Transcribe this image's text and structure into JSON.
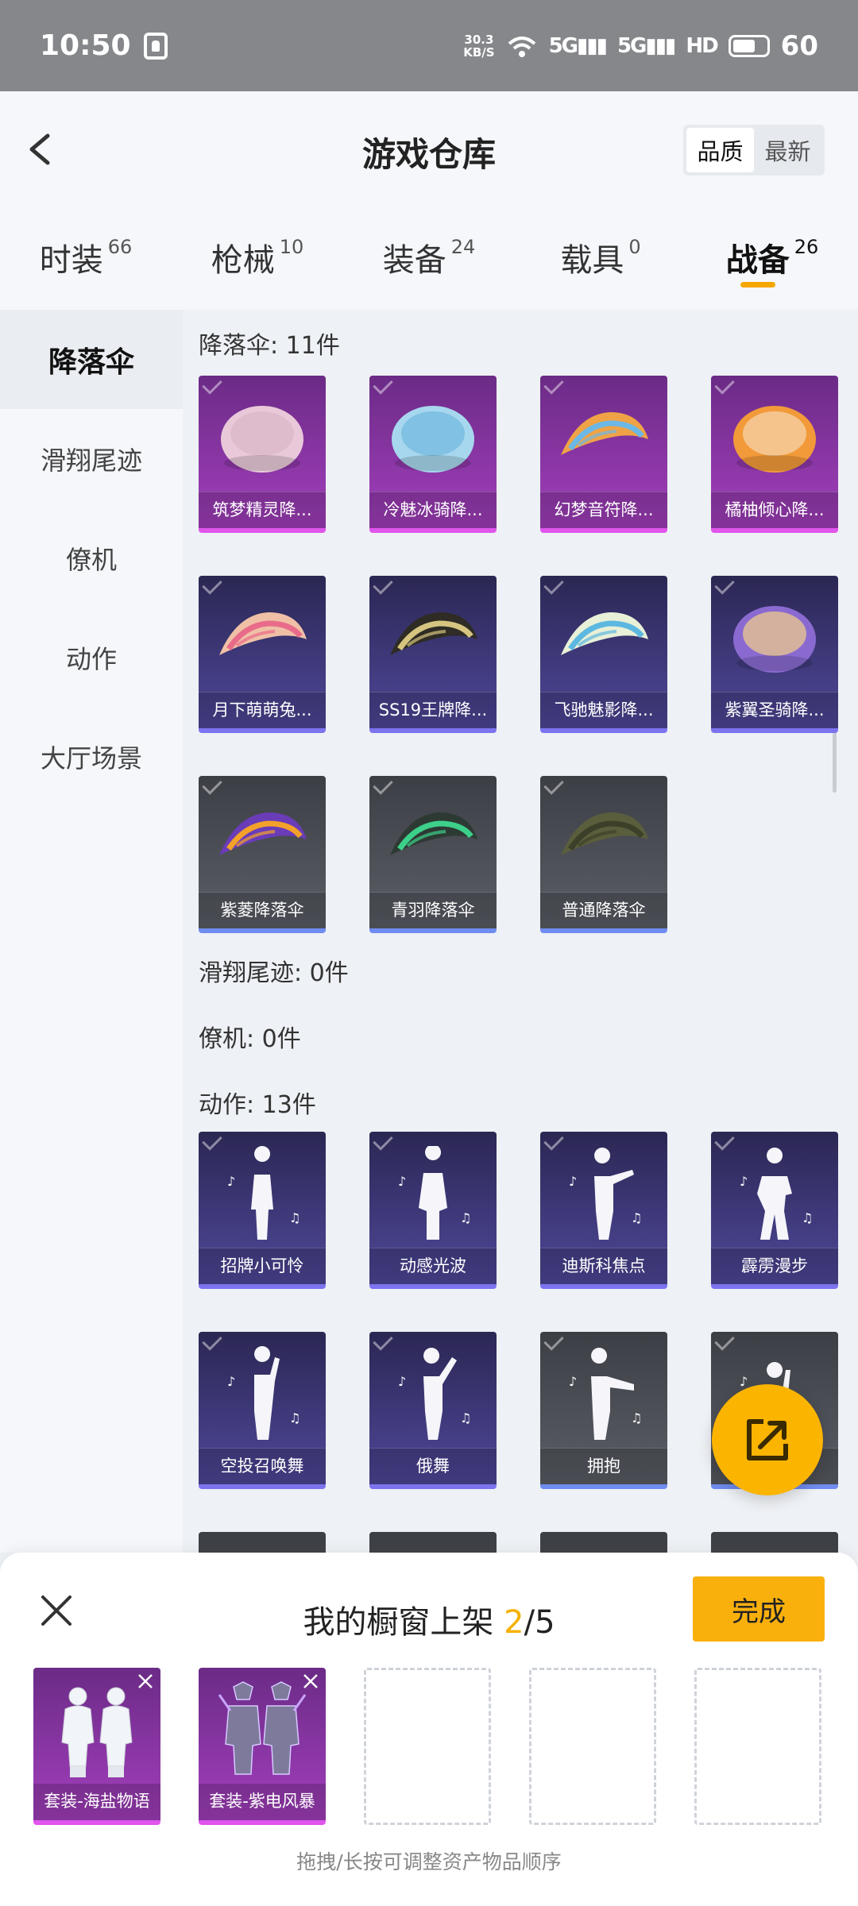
{
  "status_bar": {
    "time": "10:50",
    "net_speed_top": "30.3",
    "net_speed_bottom": "KB/S",
    "sig1": "5G",
    "sig2": "5G",
    "hd": "HD",
    "battery": "60"
  },
  "header": {
    "title": "游戏仓库",
    "sort": [
      "品质",
      "最新"
    ],
    "sort_active": "品质"
  },
  "tabs": [
    {
      "label": "时装",
      "count": "66"
    },
    {
      "label": "枪械",
      "count": "10"
    },
    {
      "label": "装备",
      "count": "24"
    },
    {
      "label": "载具",
      "count": "0"
    },
    {
      "label": "战备",
      "count": "26"
    }
  ],
  "sidebar": [
    "降落伞",
    "滑翔尾迹",
    "僚机",
    "动作",
    "大厅场景"
  ],
  "sections": {
    "parachute": {
      "title": "降落伞: 11件"
    },
    "glide": {
      "title": "滑翔尾迹: 0件"
    },
    "wingman": {
      "title": "僚机: 0件"
    },
    "emote": {
      "title": "动作: 13件"
    }
  },
  "parachutes": [
    {
      "name": "筑梦精灵降...",
      "rarity": "purple",
      "color": "#e9c9d9",
      "stripe": "#d9b6c6"
    },
    {
      "name": "冷魅冰骑降...",
      "rarity": "purple",
      "color": "#a7d7ee",
      "stripe": "#6fb8e0"
    },
    {
      "name": "幻梦音符降...",
      "rarity": "purple",
      "color": "#f0a346",
      "stripe": "#6cb8e6"
    },
    {
      "name": "橘柚倾心降...",
      "rarity": "purple",
      "color": "#f29a3a",
      "stripe": "#f7d6b0"
    },
    {
      "name": "月下萌萌兔...",
      "rarity": "blue",
      "color": "#f0c0a6",
      "stripe": "#e96b8a"
    },
    {
      "name": "SS19王牌降...",
      "rarity": "blue",
      "color": "#2e2c24",
      "stripe": "#d6c580"
    },
    {
      "name": "飞驰魅影降...",
      "rarity": "blue",
      "color": "#e9f0d8",
      "stripe": "#5cb8e0"
    },
    {
      "name": "紫翼圣骑降...",
      "rarity": "blue",
      "color": "#8a6ad0",
      "stripe": "#f3d08a"
    },
    {
      "name": "紫菱降落伞",
      "rarity": "gray",
      "color": "#6a3cb8",
      "stripe": "#f3a12a"
    },
    {
      "name": "青羽降落伞",
      "rarity": "gray",
      "color": "#2d3a34",
      "stripe": "#3dd08a"
    },
    {
      "name": "普通降落伞",
      "rarity": "gray",
      "color": "#5a5e3c",
      "stripe": "#3d4028"
    }
  ],
  "emotes": [
    {
      "name": "招牌小可怜",
      "rarity": "blue"
    },
    {
      "name": "动感光波",
      "rarity": "blue"
    },
    {
      "name": "迪斯科焦点",
      "rarity": "blue"
    },
    {
      "name": "霹雳漫步",
      "rarity": "blue"
    },
    {
      "name": "空投召唤舞",
      "rarity": "blue"
    },
    {
      "name": "俄舞",
      "rarity": "blue"
    },
    {
      "name": "拥抱",
      "rarity": "gray"
    },
    {
      "name": "",
      "rarity": "gray"
    }
  ],
  "sheet": {
    "title_prefix": "我的橱窗上架 ",
    "current": "2",
    "total": "/5",
    "done": "完成",
    "slots": [
      {
        "label": "套装-海盐物语"
      },
      {
        "label": "套装-紫电风暴"
      }
    ],
    "hint": "拖拽/长按可调整资产物品顺序"
  },
  "colors": {
    "accent": "#f5a700",
    "purple_rarity": "#e055ec",
    "blue_rarity": "#7c74ef"
  }
}
